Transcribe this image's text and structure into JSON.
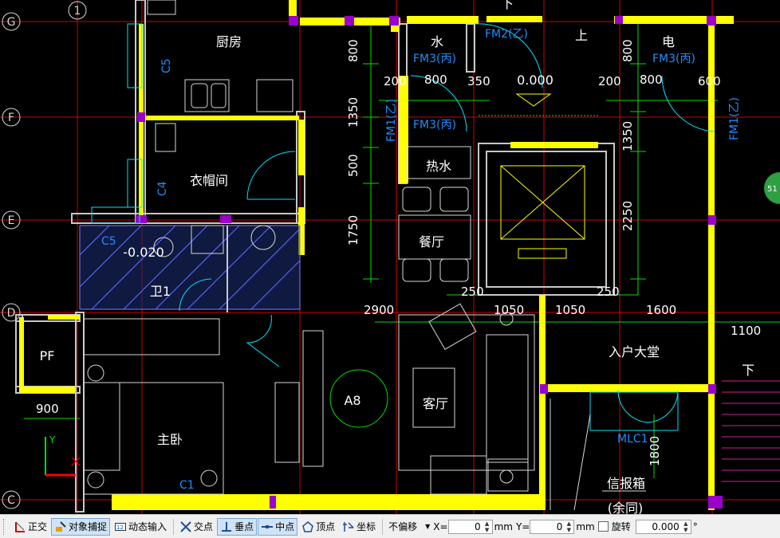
{
  "drawing": {
    "grid_labels_left": [
      "G",
      "F",
      "E",
      "D",
      "C"
    ],
    "grid_label_top": "1",
    "rooms": {
      "kitchen": "厨房",
      "cloakroom": "衣帽间",
      "bath1": "卫1",
      "master_bedroom": "主卧",
      "dining": "餐厅",
      "living": "客厅",
      "water": "水",
      "electric": "电",
      "hot_water": "热水",
      "lobby": "入户大堂",
      "pf": "PF",
      "mailbox": "信报箱",
      "mailbox_note": "(余同)",
      "up": "上",
      "down_top": "下",
      "down_stair": "下"
    },
    "tags": {
      "c5_top": "C5",
      "c4": "C4",
      "c5_bath": "C5",
      "c1": "C1",
      "fm2": "FM2(乙)",
      "fm3_water": "FM3(丙)",
      "fm3_elec": "FM3(丙)",
      "fm3_mid": "FM3(丙)",
      "fm1_left": "FM1(乙)",
      "fm1_right": "FM1(乙)",
      "mlc1": "MLC1",
      "a8": "A8",
      "level_bath": "-0.020",
      "level_hall": "0.000"
    },
    "dims": {
      "d800_v1": "800",
      "d1350_v1": "1350",
      "d500_v": "500",
      "d1750_v": "1750",
      "d800_v2": "800",
      "d1350_v2": "1350",
      "d2250_v": "2250",
      "d1800_v": "1800",
      "d200_a": "200",
      "d800_a": "800",
      "d350": "350",
      "d200_b": "200",
      "d800_b": "800",
      "d600": "600",
      "d250_a": "250",
      "d250_b": "250",
      "d2900": "2900",
      "d1050_a": "1050",
      "d1050_b": "1050",
      "d1600": "1600",
      "d1100": "1100",
      "d900": "900"
    },
    "badge": "51",
    "ucs_y": "Y"
  },
  "statusbar": {
    "ortho": "正交",
    "snap": "对象捕捉",
    "dyn": "动态输入",
    "intersect": "交点",
    "perp": "垂点",
    "mid": "中点",
    "vertex": "顶点",
    "coord": "坐标",
    "offset": "不偏移",
    "x_label": "X=",
    "x_value": "0",
    "x_unit": "mm",
    "y_label": "Y=",
    "y_value": "0",
    "y_unit": "mm",
    "rotate": "旋转",
    "rotate_value": "0.000",
    "deg": "°"
  },
  "colors": {
    "wall": "#ffff00",
    "grid_line": "#ff0000",
    "dim": "#00ff00",
    "door": "#00e5ff",
    "text": "#ffffff",
    "tag": "#00bfff",
    "column": "#9900cc"
  }
}
